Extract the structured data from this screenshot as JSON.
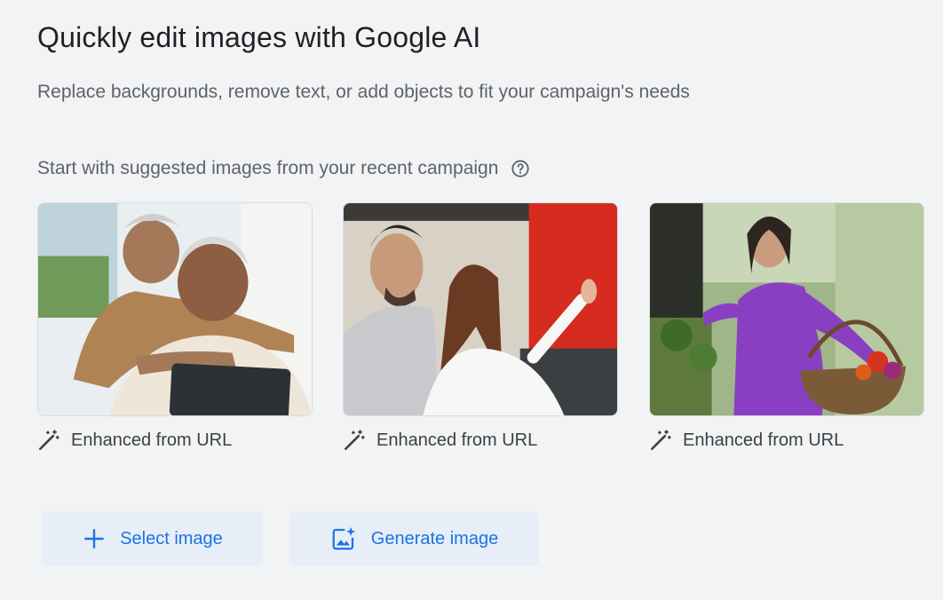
{
  "header": {
    "title": "Quickly edit images with Google AI",
    "subtitle": "Replace backgrounds, remove text, or add objects to fit your campaign's needs"
  },
  "suggested": {
    "label": "Start with suggested images from your recent campaign",
    "help_icon": "help-circle-icon",
    "items": [
      {
        "caption": "Enhanced from URL",
        "icon": "magic-wand-icon"
      },
      {
        "caption": "Enhanced from URL",
        "icon": "magic-wand-icon"
      },
      {
        "caption": "Enhanced from URL",
        "icon": "magic-wand-icon"
      }
    ]
  },
  "actions": {
    "select_label": "Select image",
    "select_icon": "plus-icon",
    "generate_label": "Generate image",
    "generate_icon": "image-sparkle-icon"
  },
  "colors": {
    "background": "#f1f3f4",
    "accent": "#1a73e8",
    "button_bg": "#e8eef7"
  }
}
